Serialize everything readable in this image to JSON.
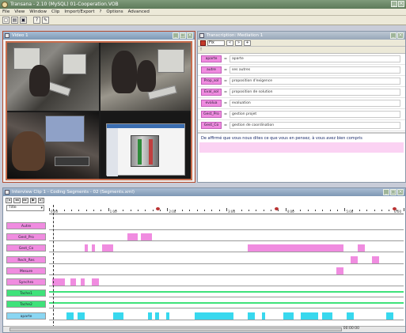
{
  "app": {
    "title": "Transana - 2.10 (MySQL) 01-Cooperation.VOB",
    "menu": [
      "File",
      "View",
      "Window",
      "Clip",
      "Import/Export",
      "?",
      "Options",
      "Advanced"
    ]
  },
  "toolbar": {
    "buttons": [
      {
        "name": "new-icon",
        "glyph": "▢"
      },
      {
        "name": "open-icon",
        "glyph": "▤"
      },
      {
        "name": "save-icon",
        "glyph": "▣"
      },
      {
        "name": "help-icon",
        "glyph": "?"
      },
      {
        "name": "settings-icon",
        "glyph": "✎"
      }
    ]
  },
  "video_window": {
    "title": "Video 1"
  },
  "transcript_window": {
    "title": "Transcription: Mediation 1",
    "tools": {
      "select_value": "Fix",
      "small_buttons": [
        "«",
        "»",
        "+"
      ]
    },
    "codes": [
      {
        "tag": "aparte",
        "desc": "aparte"
      },
      {
        "tag": "autre",
        "desc": "ses autres"
      },
      {
        "tag": "Prop_sol",
        "desc": "proposition d'exigence"
      },
      {
        "tag": "Eval_sol",
        "desc": "proposition de solution"
      },
      {
        "tag": "evalua",
        "desc": "evaluation"
      },
      {
        "tag": "Gest_Pro",
        "desc": "gestion projet"
      },
      {
        "tag": "Gest_Co",
        "desc": "gestion de coordination"
      }
    ],
    "text": "De affirmé que vous nous dites ce que vous en pensez, à vous avez bien compris"
  },
  "timeline_window": {
    "title": "Interview Clip 1 - Coding Segments - 02 (Segments.xml)",
    "controls": [
      "|◂",
      "◂◂",
      "▸▸",
      "▶",
      "▸|"
    ],
    "view_select": "Title",
    "ticks": [
      "0:00",
      "1:00",
      "2:00",
      "3:00",
      "4:00",
      "5:00",
      "6:00"
    ],
    "time_display": "00:00:00",
    "tracks": [
      {
        "label": "Autre",
        "color": "pink",
        "segments": []
      },
      {
        "label": "Gest_Pro",
        "color": "pink",
        "segments": [
          [
            0.22,
            0.25
          ],
          [
            0.26,
            0.29
          ]
        ]
      },
      {
        "label": "Gest_Co",
        "color": "pink",
        "segments": [
          [
            0.1,
            0.11
          ],
          [
            0.12,
            0.13
          ],
          [
            0.15,
            0.18
          ],
          [
            0.56,
            0.83
          ],
          [
            0.87,
            0.89
          ]
        ]
      },
      {
        "label": "Rech_Res",
        "color": "pink",
        "segments": [
          [
            0.85,
            0.87
          ],
          [
            0.91,
            0.93
          ]
        ]
      },
      {
        "label": "Mesure",
        "color": "pink",
        "segments": [
          [
            0.81,
            0.83
          ]
        ]
      },
      {
        "label": "Synchro",
        "color": "pink",
        "segments": [
          [
            0.01,
            0.045
          ],
          [
            0.06,
            0.075
          ],
          [
            0.09,
            0.1
          ],
          [
            0.12,
            0.14
          ]
        ]
      },
      {
        "label": "Tache1",
        "color": "green",
        "segments": []
      },
      {
        "label": "Tache2",
        "color": "green",
        "segments": []
      },
      {
        "label": "aparte",
        "color": "cyan",
        "segments": [
          [
            0.05,
            0.07
          ],
          [
            0.08,
            0.1
          ],
          [
            0.18,
            0.21
          ],
          [
            0.28,
            0.29
          ],
          [
            0.3,
            0.31
          ],
          [
            0.33,
            0.34
          ],
          [
            0.41,
            0.52
          ],
          [
            0.56,
            0.58
          ],
          [
            0.6,
            0.61
          ],
          [
            0.66,
            0.69
          ],
          [
            0.71,
            0.76
          ],
          [
            0.77,
            0.8
          ],
          [
            0.84,
            0.86
          ],
          [
            0.95,
            0.97
          ]
        ]
      }
    ]
  }
}
